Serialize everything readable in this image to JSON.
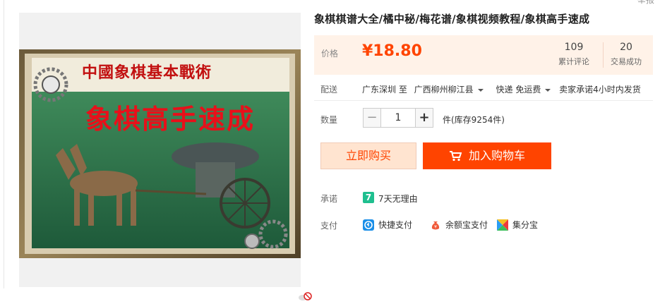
{
  "header": {
    "top_right_text": "举报"
  },
  "product": {
    "title": "象棋棋谱大全/橘中秘/梅花谱/象棋视频教程/象棋高手速成",
    "image": {
      "top_text": "中國象棋基本戰術",
      "main_text": "象棋高手速成"
    }
  },
  "price": {
    "label": "价格",
    "value": "¥18.80",
    "stats": [
      {
        "num": "109",
        "label": "累计评论"
      },
      {
        "num": "20",
        "label": "交易成功"
      }
    ]
  },
  "delivery": {
    "label": "配送",
    "from": "广东深圳 至",
    "to": "广西柳州柳江县",
    "shipping": "快递 免运费",
    "promise": "卖家承诺4小时内发货"
  },
  "quantity": {
    "label": "数量",
    "value": "1",
    "minus": "−",
    "plus": "+",
    "stock": "件(库存9254件)"
  },
  "actions": {
    "buy_now": "立即购买",
    "add_cart": "加入购物车"
  },
  "promise": {
    "label": "承诺",
    "icon_text": "7",
    "text": "7天无理由"
  },
  "payment": {
    "label": "支付",
    "methods": [
      "快捷支付",
      "余额宝支付",
      "集分宝"
    ]
  },
  "colors": {
    "accent": "#ff4400",
    "price_bg": "#fff2e8",
    "buy_bg": "#ffe4d0",
    "promise_green": "#1fbf8f"
  }
}
